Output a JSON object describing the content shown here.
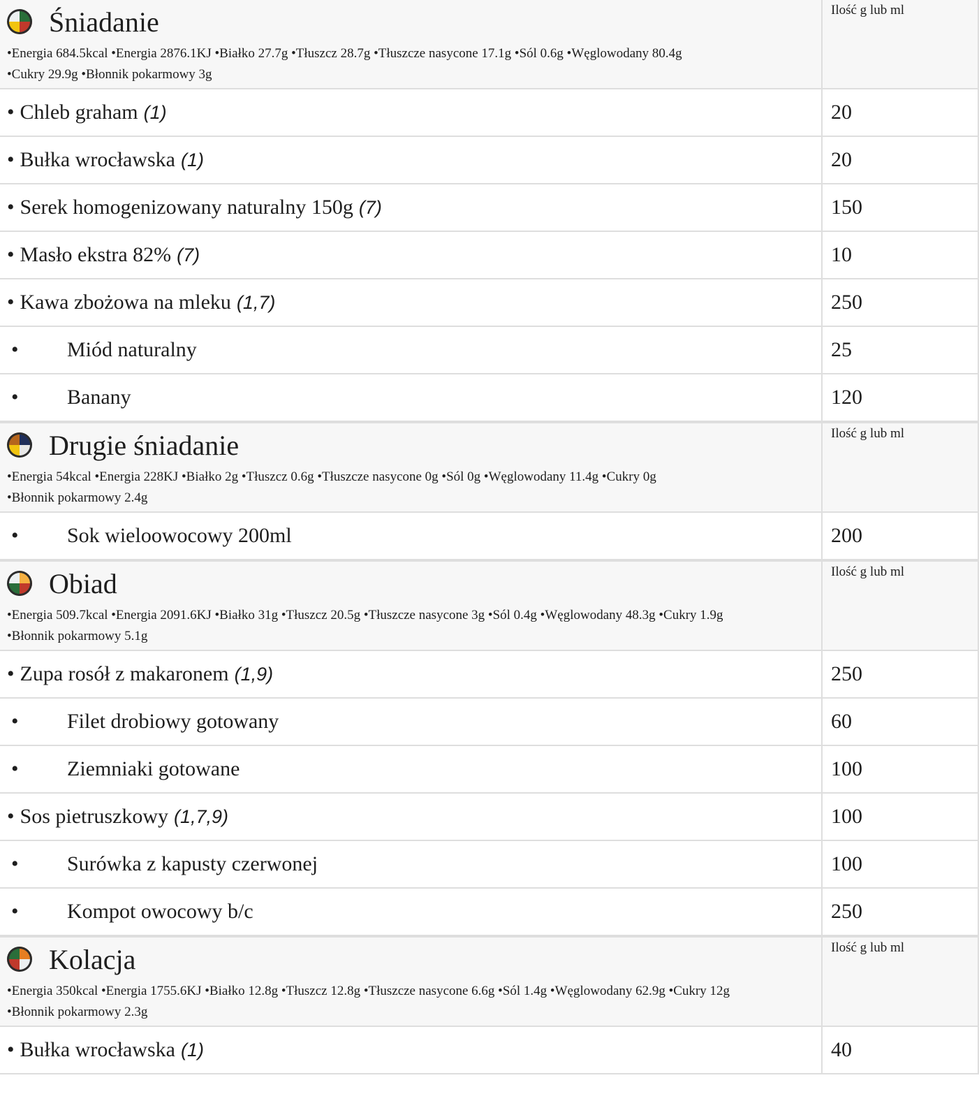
{
  "qty_header": "Ilość g lub ml",
  "meals": [
    {
      "title": "Śniadanie",
      "icon": "breakfast-plate-icon",
      "nutrition_line1": "•Energia 684.5kcal •Energia 2876.1KJ •Białko 27.7g •Tłuszcz 28.7g •Tłuszcze nasycone 17.1g •Sól 0.6g •Węglowodany 80.4g",
      "nutrition_line2": "•Cukry 29.9g •Błonnik pokarmowy 3g",
      "items": [
        {
          "name": "Chleb graham",
          "allergens": "(1)",
          "qty": "20",
          "style": "inline"
        },
        {
          "name": "Bułka wrocławska",
          "allergens": "(1)",
          "qty": "20",
          "style": "inline"
        },
        {
          "name": "Serek homogenizowany naturalny 150g",
          "allergens": "(7)",
          "qty": "150",
          "style": "inline"
        },
        {
          "name": "Masło ekstra 82%",
          "allergens": "(7)",
          "qty": "10",
          "style": "inline"
        },
        {
          "name": "Kawa zbożowa na mleku",
          "allergens": "(1,7)",
          "qty": "250",
          "style": "inline"
        },
        {
          "name": "Miód naturalny",
          "allergens": "",
          "qty": "25",
          "style": "indent"
        },
        {
          "name": "Banany",
          "allergens": "",
          "qty": "120",
          "style": "indent"
        }
      ]
    },
    {
      "title": "Drugie śniadanie",
      "icon": "second-breakfast-plate-icon",
      "nutrition_line1": "•Energia 54kcal •Energia 228KJ •Białko 2g •Tłuszcz 0.6g •Tłuszcze nasycone 0g •Sól 0g •Węglowodany 11.4g •Cukry 0g",
      "nutrition_line2": "•Błonnik pokarmowy 2.4g",
      "items": [
        {
          "name": "Sok wieloowocowy 200ml",
          "allergens": "",
          "qty": "200",
          "style": "indent"
        }
      ]
    },
    {
      "title": "Obiad",
      "icon": "lunch-plate-icon",
      "nutrition_line1": "•Energia 509.7kcal •Energia 2091.6KJ •Białko 31g •Tłuszcz 20.5g •Tłuszcze nasycone 3g •Sól 0.4g •Węglowodany 48.3g •Cukry 1.9g",
      "nutrition_line2": "•Błonnik pokarmowy 5.1g",
      "items": [
        {
          "name": "Zupa rosół z makaronem",
          "allergens": "(1,9)",
          "qty": "250",
          "style": "inline"
        },
        {
          "name": "Filet drobiowy gotowany",
          "allergens": "",
          "qty": "60",
          "style": "indent"
        },
        {
          "name": "Ziemniaki gotowane",
          "allergens": "",
          "qty": "100",
          "style": "indent"
        },
        {
          "name": "Sos pietruszkowy",
          "allergens": "(1,7,9)",
          "qty": "100",
          "style": "inline"
        },
        {
          "name": "Surówka z kapusty czerwonej",
          "allergens": "",
          "qty": "100",
          "style": "indent"
        },
        {
          "name": "Kompot owocowy b/c",
          "allergens": "",
          "qty": "250",
          "style": "indent"
        }
      ]
    },
    {
      "title": "Kolacja",
      "icon": "dinner-plate-icon",
      "nutrition_line1": "•Energia 350kcal •Energia 1755.6KJ •Białko 12.8g •Tłuszcz 12.8g •Tłuszcze nasycone 6.6g •Sól 1.4g •Węglowodany 62.9g •Cukry 12g",
      "nutrition_line2": "•Błonnik pokarmowy 2.3g",
      "items": [
        {
          "name": "Bułka wrocławska",
          "allergens": "(1)",
          "qty": "40",
          "style": "inline"
        }
      ]
    }
  ]
}
